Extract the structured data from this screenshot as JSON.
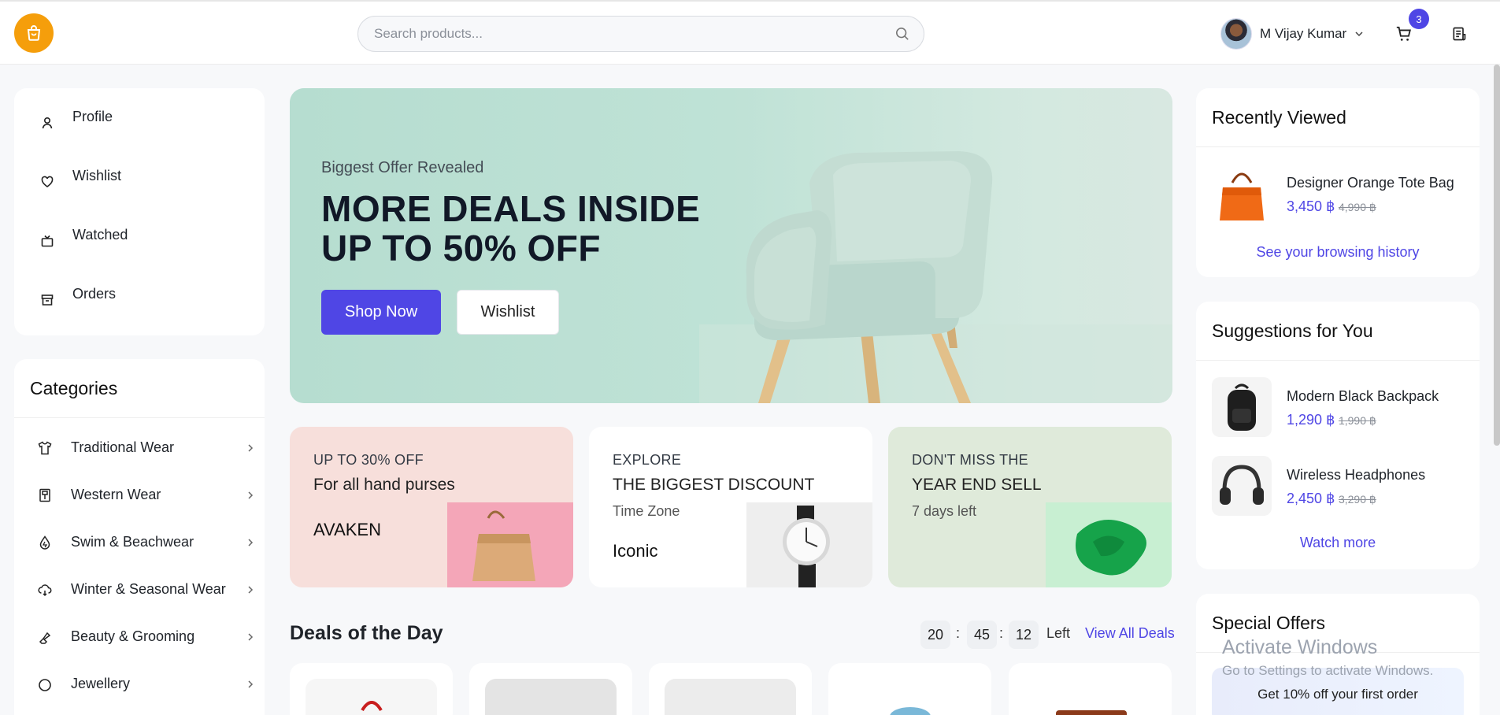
{
  "header": {
    "search_placeholder": "Search products...",
    "user_name": "M Vijay Kumar",
    "cart_count": "3"
  },
  "account_nav": {
    "items": [
      {
        "label": "Profile",
        "icon": "user-icon"
      },
      {
        "label": "Wishlist",
        "icon": "heart-icon"
      },
      {
        "label": "Watched",
        "icon": "tv-icon"
      },
      {
        "label": "Orders",
        "icon": "archive-icon"
      }
    ]
  },
  "categories": {
    "title": "Categories",
    "items": [
      {
        "label": "Traditional Wear",
        "icon": "shirt-icon"
      },
      {
        "label": "Western Wear",
        "icon": "dress-icon"
      },
      {
        "label": "Swim & Beachwear",
        "icon": "drop-icon"
      },
      {
        "label": "Winter & Seasonal Wear",
        "icon": "cloud-icon"
      },
      {
        "label": "Beauty & Grooming",
        "icon": "lipstick-icon"
      },
      {
        "label": "Jewellery",
        "icon": "ring-icon"
      }
    ]
  },
  "hero": {
    "eyebrow": "Biggest Offer Revealed",
    "title_line1": "MORE DEALS INSIDE",
    "title_line2": "UP TO 50% OFF",
    "primary_button": "Shop Now",
    "secondary_button": "Wishlist"
  },
  "promos": [
    {
      "line1": "UP TO 30% OFF",
      "line2": "For all hand purses",
      "line3": "",
      "line4": "AVAKEN",
      "bg": "#f7dfdb"
    },
    {
      "line1": "EXPLORE",
      "line2": "THE BIGGEST DISCOUNT",
      "line3": "Time Zone",
      "line4": "Iconic",
      "bg": "#ffffff"
    },
    {
      "line1": "DON'T MISS THE",
      "line2": "YEAR END SELL",
      "line3": "7 days left",
      "line4": "",
      "bg": "#dfeada"
    }
  ],
  "deals": {
    "title": "Deals of the Day",
    "timer": {
      "hours": "20",
      "minutes": "45",
      "seconds": "12",
      "sep": ":"
    },
    "left_label": "Left",
    "view_all": "View All Deals"
  },
  "recently_viewed": {
    "title": "Recently Viewed",
    "items": [
      {
        "name": "Designer Orange Tote Bag",
        "price": "3,450 ฿",
        "old_price": "4,990 ฿"
      }
    ],
    "link": "See your browsing history"
  },
  "suggestions": {
    "title": "Suggestions for You",
    "items": [
      {
        "name": "Modern Black Backpack",
        "price": "1,290 ฿",
        "old_price": "1,990 ฿"
      },
      {
        "name": "Wireless Headphones",
        "price": "2,450 ฿",
        "old_price": "3,290 ฿"
      }
    ],
    "link": "Watch more"
  },
  "special_offers": {
    "title": "Special Offers",
    "offer_text": "Get 10% off your first order"
  },
  "watermark": {
    "line1": "Activate Windows",
    "line2": "Go to Settings to activate Windows."
  },
  "colors": {
    "accent": "#4f46e5",
    "logo": "#f59e0b"
  }
}
